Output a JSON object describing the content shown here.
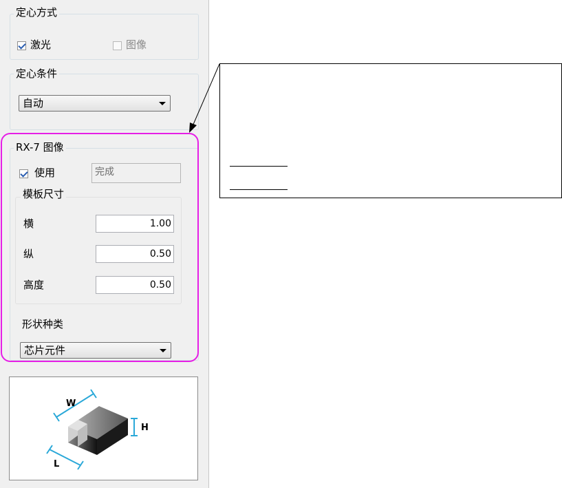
{
  "centering_method": {
    "title": "定心方式",
    "laser": {
      "label": "激光",
      "checked": true
    },
    "image": {
      "label": "图像",
      "checked": false
    }
  },
  "centering_condition": {
    "title": "定心条件",
    "select": {
      "value": "自动"
    }
  },
  "rx7_image": {
    "title": "RX-7 图像",
    "use": {
      "label": "使用",
      "checked": true
    },
    "status": "完成",
    "template_size": {
      "title": "模板尺寸",
      "width": {
        "label": "横",
        "value": "1.00"
      },
      "depth": {
        "label": "纵",
        "value": "0.50"
      },
      "height": {
        "label": "高度",
        "value": "0.50"
      }
    },
    "shape_type": {
      "label": "形状种类",
      "value": "芯片元件"
    }
  },
  "preview": {
    "dim_w": "W",
    "dim_h": "H",
    "dim_l": "L"
  },
  "colors": {
    "highlight": "#e61ee6",
    "dimension": "#2aa8d8"
  }
}
